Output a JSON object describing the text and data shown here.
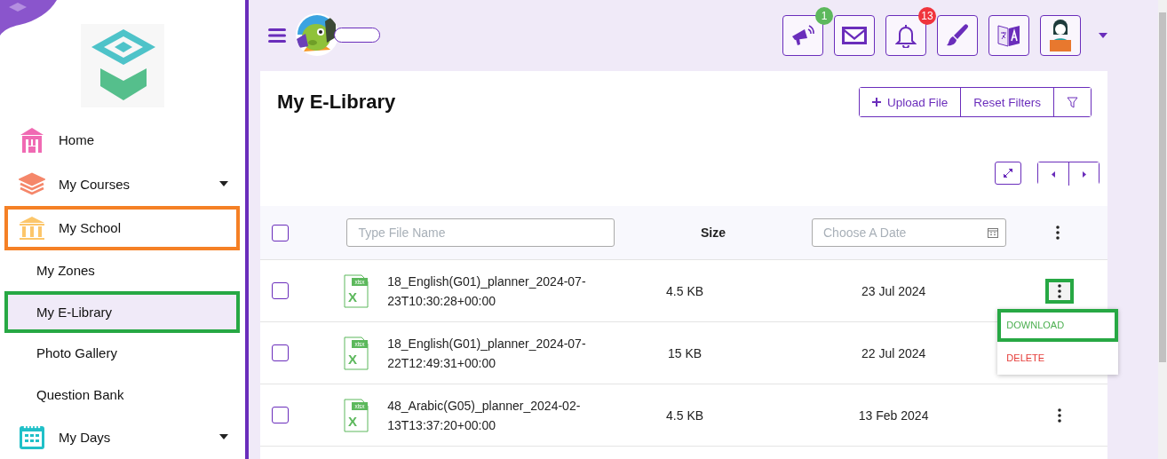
{
  "sidebar": {
    "items": [
      {
        "label": "Home",
        "kind": "main",
        "expandable": false,
        "selected": false
      },
      {
        "label": "My Courses",
        "kind": "main",
        "expandable": true,
        "selected": false
      },
      {
        "label": "My School",
        "kind": "main",
        "expandable": false,
        "selected": false,
        "color": "#f58025"
      },
      {
        "label": "My Zones",
        "kind": "sub",
        "selected": false
      },
      {
        "label": "My E-Library",
        "kind": "sub",
        "selected": true,
        "color": "#27a844"
      },
      {
        "label": "Photo Gallery",
        "kind": "sub",
        "selected": false
      },
      {
        "label": "Question Bank",
        "kind": "sub",
        "selected": false
      },
      {
        "label": "My Days",
        "kind": "main",
        "expandable": true,
        "selected": false
      }
    ]
  },
  "header": {
    "actions": [
      {
        "kind": "badged",
        "badge": "1",
        "color": "#5cb85c"
      },
      {
        "kind": "plain"
      },
      {
        "kind": "badged",
        "badge": "13",
        "color": "#f0343c"
      },
      {
        "kind": "plain"
      },
      {
        "kind": "plain"
      },
      {
        "kind": "plain"
      }
    ]
  },
  "page": {
    "title": "My E-Library",
    "toolbar": [
      {
        "label": "Upload File",
        "kind": "upload"
      },
      {
        "label": "Reset Filters",
        "kind": "reset"
      },
      {
        "kind": "filter"
      }
    ]
  },
  "table": {
    "name_filter": {
      "placeholder": "Type File Name"
    },
    "size_header": "Size",
    "date_filter": {
      "placeholder": "Choose A Date"
    },
    "select_all": {
      "checked": false
    },
    "rows": [
      {
        "file_type": "xlsx",
        "file_letter": "X",
        "name": "18_English(G01)_planner_2024-07-23T10:30:28+00:00",
        "size": "4.5 KB",
        "date": "23 Jul 2024",
        "checked": false,
        "menu_open": true,
        "color": "#27a844"
      },
      {
        "file_type": "xlsx",
        "file_letter": "X",
        "name": "18_English(G01)_planner_2024-07-22T12:49:31+00:00",
        "size": "15 KB",
        "date": "22 Jul 2024",
        "checked": false,
        "menu_open": false
      },
      {
        "file_type": "xlsx",
        "file_letter": "X",
        "name": "48_Arabic(G05)_planner_2024-02-13T13:37:20+00:00",
        "size": "4.5 KB",
        "date": "13 Feb 2024",
        "checked": false,
        "menu_open": false
      }
    ],
    "row_menu": {
      "items": [
        {
          "label": "DOWNLOAD",
          "kind": "download",
          "color": "#27a844"
        },
        {
          "label": "DELETE",
          "kind": "delete"
        }
      ]
    }
  }
}
